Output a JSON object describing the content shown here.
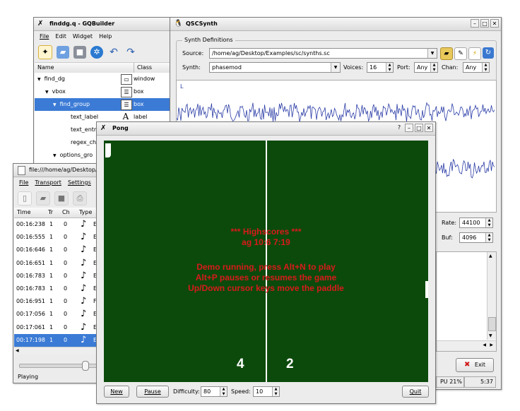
{
  "gqbuilder": {
    "title": "finddg.q - GQBuilder",
    "menu": [
      "File",
      "Edit",
      "Widget",
      "Help"
    ],
    "col_name": "Name",
    "col_class": "Class",
    "tree": [
      {
        "name": "find_dg",
        "cls": "window",
        "indent": 0,
        "arrow": "▼"
      },
      {
        "name": "vbox",
        "cls": "box",
        "indent": 1,
        "arrow": "▼"
      },
      {
        "name": "find_group",
        "cls": "box",
        "indent": 2,
        "arrow": "▼",
        "selected": true
      },
      {
        "name": "text_label",
        "cls": "label",
        "indent": 3,
        "arrow": ""
      },
      {
        "name": "text_entry",
        "cls": "",
        "indent": 3,
        "arrow": ""
      },
      {
        "name": "regex_ch",
        "cls": "",
        "indent": 3,
        "arrow": ""
      },
      {
        "name": "options_gro",
        "cls": "",
        "indent": 2,
        "arrow": "▼"
      }
    ]
  },
  "qscsynth": {
    "title": "QSCSynth",
    "group_title": "Synth Definitions",
    "source_label": "Source:",
    "source_value": "/home/ag/Desktop/Examples/sc/synths.sc",
    "synth_label": "Synth:",
    "synth_value": "phasemod",
    "voices_label": "Voices:",
    "voices_value": "16",
    "port_label": "Port:",
    "port_value": "Any",
    "chan_label": "Chan:",
    "chan_value": "Any",
    "wave_left_label": "L",
    "rate_label": "Rate:",
    "rate_value": "44100",
    "buf_label": "Buf:",
    "buf_value": "4096",
    "exit_label": "Exit",
    "cpu_text": "PU 21%",
    "time_text": "5:37",
    "wave_color": "#2a3ca6"
  },
  "midi": {
    "title": "file:///home/ag/Desktop/E",
    "menu": [
      "File",
      "Transport",
      "Settings"
    ],
    "headers": [
      "Time",
      "Tr",
      "Ch",
      "Type"
    ],
    "rows": [
      {
        "time": "00:16:238",
        "tr": "1",
        "ch": "0",
        "type": "E"
      },
      {
        "time": "00:16:555",
        "tr": "1",
        "ch": "0",
        "type": "E"
      },
      {
        "time": "00:16:646",
        "tr": "1",
        "ch": "0",
        "type": "E"
      },
      {
        "time": "00:16:651",
        "tr": "1",
        "ch": "0",
        "type": "E"
      },
      {
        "time": "00:16:783",
        "tr": "1",
        "ch": "0",
        "type": "E"
      },
      {
        "time": "00:16:783",
        "tr": "1",
        "ch": "0",
        "type": "E"
      },
      {
        "time": "00:16:951",
        "tr": "1",
        "ch": "0",
        "type": "F"
      },
      {
        "time": "00:17:056",
        "tr": "1",
        "ch": "0",
        "type": "E"
      },
      {
        "time": "00:17:061",
        "tr": "1",
        "ch": "0",
        "type": "E"
      },
      {
        "time": "00:17:198",
        "tr": "1",
        "ch": "0",
        "type": "E",
        "selected": true
      }
    ],
    "status": "Playing"
  },
  "pong": {
    "title": "Pong",
    "highscores": "*** Highscores ***",
    "score_entry": "ag 10:6 7:19",
    "line1": "Demo running, press Alt+N to play",
    "line2": "Alt+P pauses or resumes the game",
    "line3": "Up/Down cursor keys move the paddle",
    "score_left": "4",
    "score_right": "2",
    "new_label": "New",
    "pause_label": "Pause",
    "difficulty_label": "Difficulty:",
    "difficulty_value": "80",
    "speed_label": "Speed:",
    "speed_value": "10",
    "quit_label": "Quit",
    "field_color": "#0c4a0c",
    "text_color": "#d81a1a"
  }
}
